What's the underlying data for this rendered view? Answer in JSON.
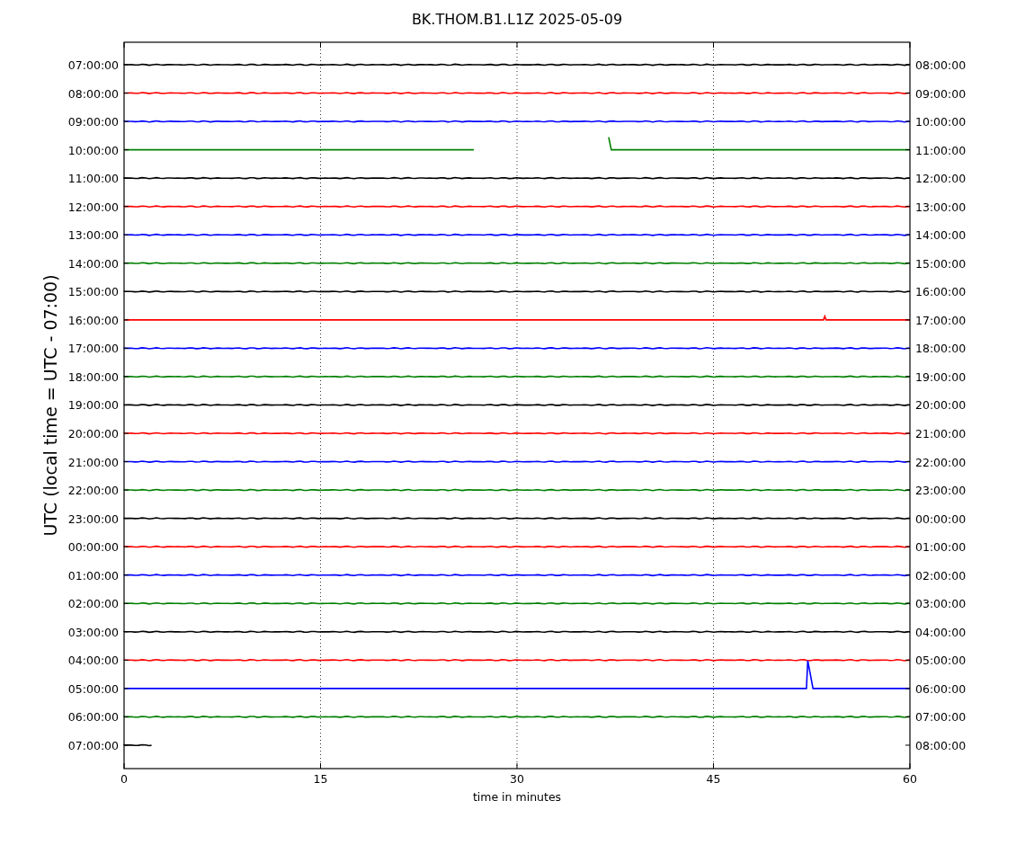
{
  "title": "BK.THOM.B1.L1Z 2025-05-09",
  "ylabel": "UTC (local time = UTC - 07:00)",
  "xlabel": "time in minutes",
  "xticks": [
    "0",
    "15",
    "30",
    "45",
    "60"
  ],
  "rows": [
    {
      "left": "07:00:00",
      "right": "08:00:00",
      "color": "#000000",
      "kind": "flat"
    },
    {
      "left": "08:00:00",
      "right": "09:00:00",
      "color": "#ff0000",
      "kind": "flat"
    },
    {
      "left": "09:00:00",
      "right": "10:00:00",
      "color": "#0000ff",
      "kind": "flat"
    },
    {
      "left": "10:00:00",
      "right": "11:00:00",
      "color": "#008000",
      "kind": "gap"
    },
    {
      "left": "11:00:00",
      "right": "12:00:00",
      "color": "#000000",
      "kind": "flat"
    },
    {
      "left": "12:00:00",
      "right": "13:00:00",
      "color": "#ff0000",
      "kind": "flat"
    },
    {
      "left": "13:00:00",
      "right": "14:00:00",
      "color": "#0000ff",
      "kind": "flat"
    },
    {
      "left": "14:00:00",
      "right": "15:00:00",
      "color": "#008000",
      "kind": "flat"
    },
    {
      "left": "15:00:00",
      "right": "16:00:00",
      "color": "#000000",
      "kind": "flat"
    },
    {
      "left": "16:00:00",
      "right": "17:00:00",
      "color": "#ff0000",
      "kind": "blip"
    },
    {
      "left": "17:00:00",
      "right": "18:00:00",
      "color": "#0000ff",
      "kind": "flat"
    },
    {
      "left": "18:00:00",
      "right": "19:00:00",
      "color": "#008000",
      "kind": "flat"
    },
    {
      "left": "19:00:00",
      "right": "20:00:00",
      "color": "#000000",
      "kind": "flat"
    },
    {
      "left": "20:00:00",
      "right": "21:00:00",
      "color": "#ff0000",
      "kind": "flat"
    },
    {
      "left": "21:00:00",
      "right": "22:00:00",
      "color": "#0000ff",
      "kind": "flat"
    },
    {
      "left": "22:00:00",
      "right": "23:00:00",
      "color": "#008000",
      "kind": "flat"
    },
    {
      "left": "23:00:00",
      "right": "00:00:00",
      "color": "#000000",
      "kind": "flat"
    },
    {
      "left": "00:00:00",
      "right": "01:00:00",
      "color": "#ff0000",
      "kind": "flat"
    },
    {
      "left": "01:00:00",
      "right": "02:00:00",
      "color": "#0000ff",
      "kind": "flat"
    },
    {
      "left": "02:00:00",
      "right": "03:00:00",
      "color": "#008000",
      "kind": "flat"
    },
    {
      "left": "03:00:00",
      "right": "04:00:00",
      "color": "#000000",
      "kind": "flat"
    },
    {
      "left": "04:00:00",
      "right": "05:00:00",
      "color": "#ff0000",
      "kind": "flat"
    },
    {
      "left": "05:00:00",
      "right": "06:00:00",
      "color": "#0000ff",
      "kind": "spike"
    },
    {
      "left": "06:00:00",
      "right": "07:00:00",
      "color": "#008000",
      "kind": "flat"
    },
    {
      "left": "07:00:00",
      "right": "08:00:00",
      "color": "#000000",
      "kind": "partial"
    }
  ]
}
